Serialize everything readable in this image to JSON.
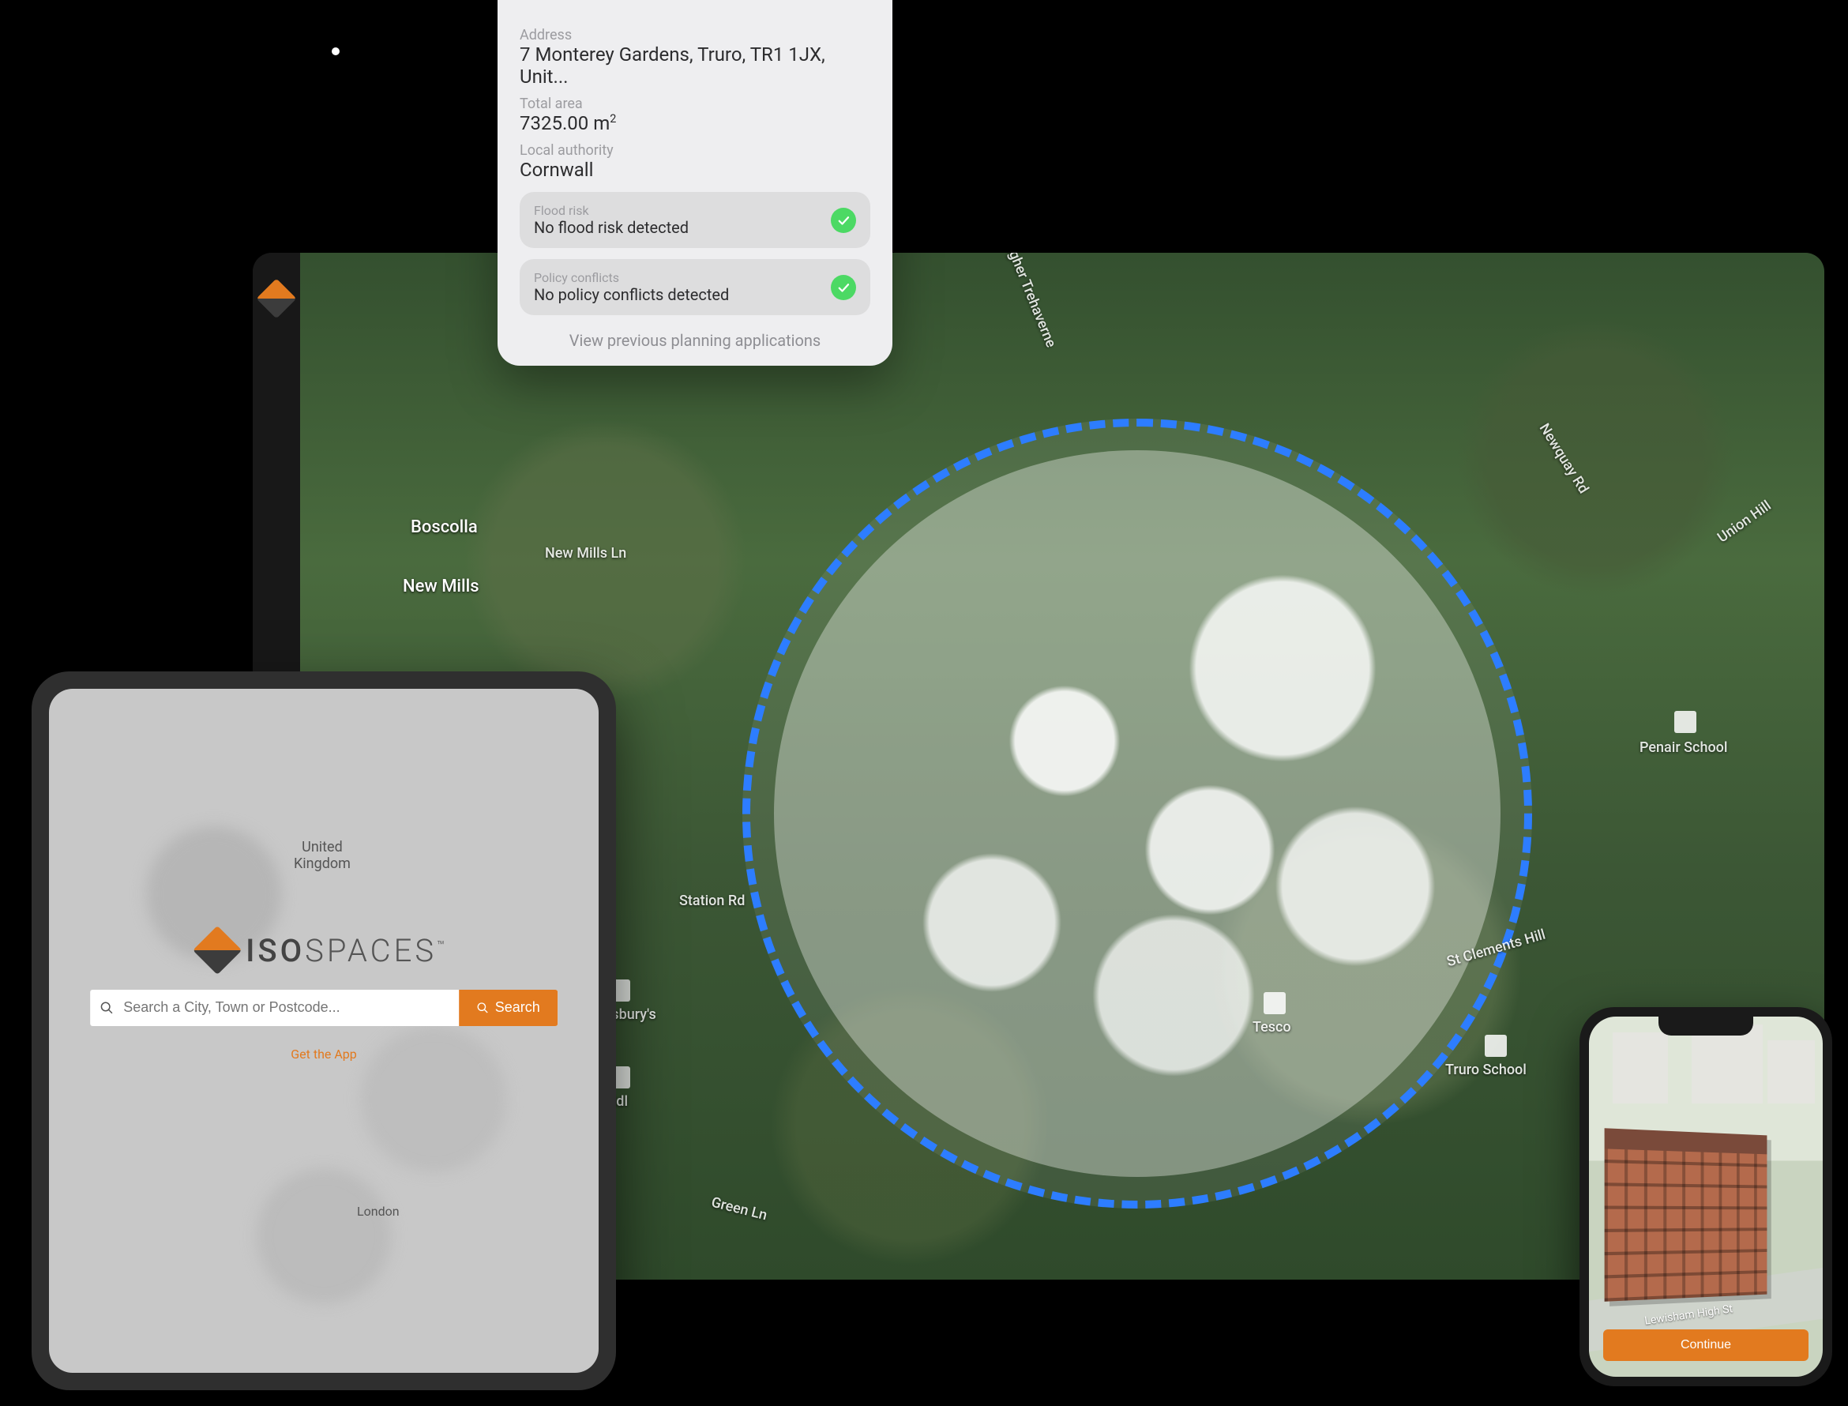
{
  "info_card": {
    "address_label": "Address",
    "address_value": "7 Monterey Gardens, Truro, TR1 1JX, Unit...",
    "area_label": "Total area",
    "area_value": "7325.00 m²",
    "authority_label": "Local authority",
    "authority_value": "Cornwall",
    "flood": {
      "label": "Flood risk",
      "value": "No flood risk detected"
    },
    "policy": {
      "label": "Policy  conflicts",
      "value": "No policy conflicts detected"
    },
    "footer_link": "View previous planning applications"
  },
  "map": {
    "labels": {
      "boscolla": "Boscolla",
      "new_mills": "New Mills",
      "new_mills_ln": "New Mills Ln",
      "higher_trehaverne": "Higher Trehaverne",
      "newquay_rd": "Newquay Rd",
      "union_hill": "Union Hill",
      "penair_school": "Penair School",
      "station_rd": "Station Rd",
      "st_clements_hill": "St Clements Hill",
      "truro_school": "Truro School",
      "green_ln": "Green Ln",
      "sainsburys": "ainsbury's",
      "lidl": "Lidl",
      "tesco": "Tesco"
    }
  },
  "tablet": {
    "brand_iso": "ISO",
    "brand_spaces": "SPACES",
    "tm": "™",
    "search_placeholder": "Search a City, Town or Postcode...",
    "search_button": "Search",
    "get_app": "Get the App",
    "uk_label": "United Kingdom",
    "london_label": "London"
  },
  "phone": {
    "road": "Lewisham High St",
    "continue": "Continue"
  },
  "colors": {
    "accent": "#e27a1f",
    "circle": "#2d7dff",
    "success": "#4cd964"
  }
}
